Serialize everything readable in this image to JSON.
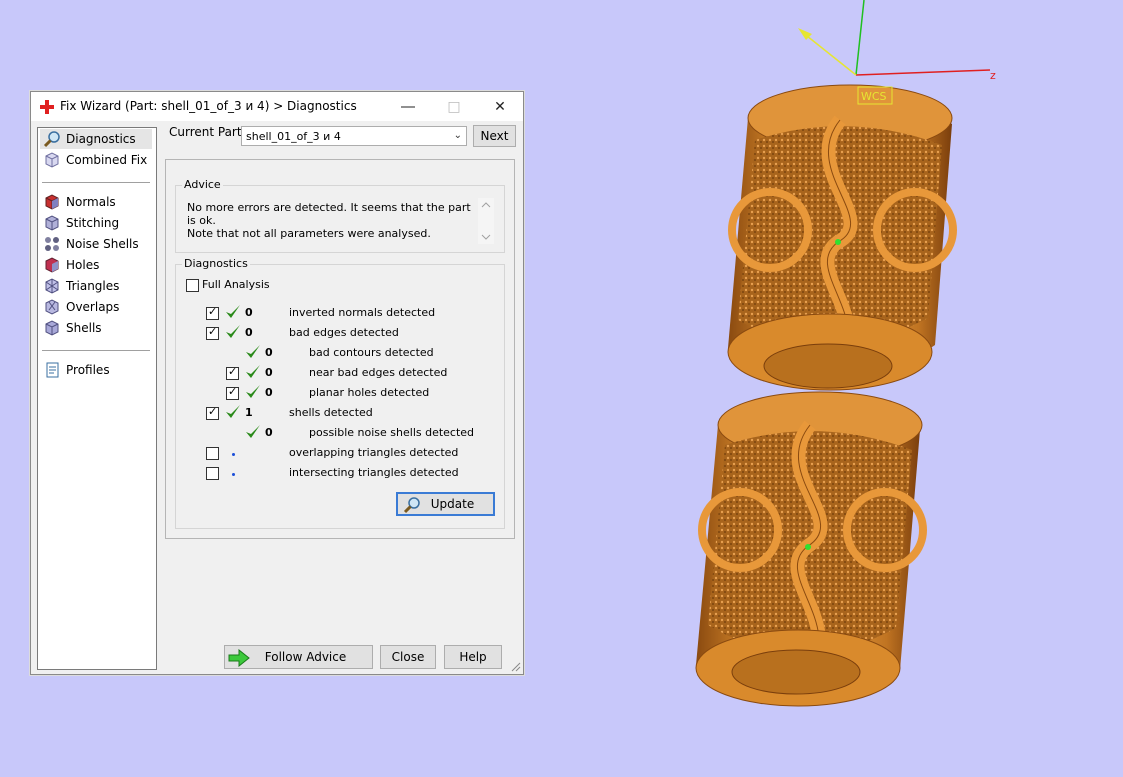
{
  "window": {
    "title": "Fix Wizard (Part: shell_01_of_3 и 4) > Diagnostics"
  },
  "nav": {
    "items": [
      {
        "label": "Diagnostics",
        "icon": "magnifier-icon"
      },
      {
        "label": "Combined Fix",
        "icon": "combined-fix-icon"
      },
      {
        "label": "Normals",
        "icon": "normals-icon"
      },
      {
        "label": "Stitching",
        "icon": "stitching-icon"
      },
      {
        "label": "Noise Shells",
        "icon": "noise-shells-icon"
      },
      {
        "label": "Holes",
        "icon": "holes-icon"
      },
      {
        "label": "Triangles",
        "icon": "triangles-icon"
      },
      {
        "label": "Overlaps",
        "icon": "overlaps-icon"
      },
      {
        "label": "Shells",
        "icon": "shells-icon"
      },
      {
        "label": "Profiles",
        "icon": "profiles-icon"
      }
    ],
    "selected": "Diagnostics"
  },
  "current_part": {
    "label": "Current Part:",
    "value": "shell_01_of_3 и 4",
    "next_label": "Next"
  },
  "advice": {
    "title": "Advice",
    "line1": "No more errors are detected. It seems that the part is ok.",
    "line2": "Note that not all parameters were analysed."
  },
  "diagnostics": {
    "title": "Diagnostics",
    "full_analysis_label": "Full Analysis",
    "rows": [
      {
        "checkbox": true,
        "status": "ok",
        "value": "0",
        "desc": "inverted normals detected"
      },
      {
        "checkbox": true,
        "status": "ok",
        "value": "0",
        "desc": "bad edges detected"
      },
      {
        "checkbox": null,
        "status": "ok",
        "value": "0",
        "desc": "bad contours detected"
      },
      {
        "checkbox": true,
        "status": "ok",
        "value": "0",
        "desc": "near bad edges detected"
      },
      {
        "checkbox": true,
        "status": "ok",
        "value": "0",
        "desc": "planar holes detected"
      },
      {
        "checkbox": true,
        "status": "ok",
        "value": "1",
        "desc": "shells detected"
      },
      {
        "checkbox": null,
        "status": "ok",
        "value": "0",
        "desc": "possible noise shells detected"
      },
      {
        "checkbox": false,
        "status": "pending",
        "value": "",
        "desc": "overlapping triangles detected"
      },
      {
        "checkbox": false,
        "status": "pending",
        "value": "",
        "desc": "intersecting triangles detected"
      }
    ],
    "update_label": "Update"
  },
  "footer": {
    "follow_advice_label": "Follow Advice",
    "close_label": "Close",
    "help_label": "Help"
  },
  "viewport": {
    "wcs_label": "WCS",
    "z_axis_label": "z"
  },
  "colors": {
    "background": "#c8c8fa",
    "model": "#d98a2c",
    "check": "#2a8a1a",
    "x_axis": "#e02020",
    "y_axis": "#20c020",
    "z_axis_arrow": "#e6e632"
  }
}
